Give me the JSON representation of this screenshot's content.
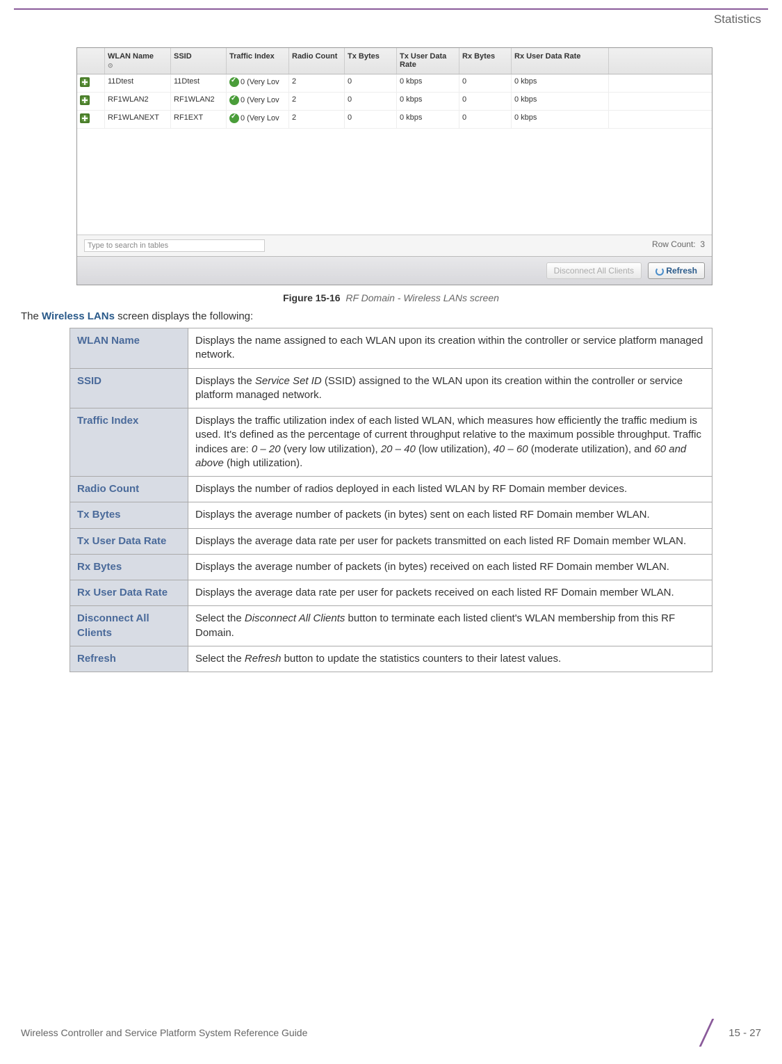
{
  "header": {
    "section": "Statistics"
  },
  "screenshot": {
    "columns": [
      "WLAN Name",
      "SSID",
      "Traffic Index",
      "Radio Count",
      "Tx Bytes",
      "Tx User Data Rate",
      "Rx Bytes",
      "Rx User Data Rate"
    ],
    "sort_indicator": "⊙",
    "rows": [
      {
        "wlan": "11Dtest",
        "ssid": "11Dtest",
        "traffic": "0 (Very Lov",
        "radio": "2",
        "txb": "0",
        "txr": "0 kbps",
        "rxb": "0",
        "rxr": "0 kbps"
      },
      {
        "wlan": "RF1WLAN2",
        "ssid": "RF1WLAN2",
        "traffic": "0 (Very Lov",
        "radio": "2",
        "txb": "0",
        "txr": "0 kbps",
        "rxb": "0",
        "rxr": "0 kbps"
      },
      {
        "wlan": "RF1WLANEXT",
        "ssid": "RF1EXT",
        "traffic": "0 (Very Lov",
        "radio": "2",
        "txb": "0",
        "txr": "0 kbps",
        "rxb": "0",
        "rxr": "0 kbps"
      }
    ],
    "search_placeholder": "Type to search in tables",
    "row_count_label": "Row Count:",
    "row_count": "3",
    "btn_disconnect": "Disconnect All Clients",
    "btn_refresh": "Refresh"
  },
  "figure": {
    "number": "Figure 15-16",
    "desc": "RF Domain - Wireless LANs screen"
  },
  "intro": {
    "pre": "The ",
    "bold": "Wireless LANs",
    "post": " screen displays the following:"
  },
  "defs": [
    {
      "term": "WLAN Name",
      "html": "Displays the name assigned to each WLAN upon its creation within the controller or service platform managed network."
    },
    {
      "term": "SSID",
      "html": "Displays the <i>Service Set ID</i> (SSID) assigned to the WLAN upon its creation within the controller or service platform managed network."
    },
    {
      "term": "Traffic Index",
      "html": "Displays the traffic utilization index of each listed WLAN, which measures how efficiently the traffic medium is used. It's defined as the percentage of current throughput relative to the maximum possible throughput. Traffic indices are: <i>0 – 20</i> (very low utilization), <i>20 – 40</i> (low utilization), <i>40 – 60</i> (moderate utilization), and <i>60 and above</i> (high utilization)."
    },
    {
      "term": "Radio Count",
      "html": "Displays the number of radios deployed in each listed WLAN by RF Domain member devices."
    },
    {
      "term": "Tx Bytes",
      "html": "Displays the average number of packets (in bytes) sent on each listed RF Domain member WLAN."
    },
    {
      "term": "Tx User Data Rate",
      "html": "Displays the average data rate per user for packets transmitted on each listed RF Domain member WLAN."
    },
    {
      "term": "Rx Bytes",
      "html": "Displays the average number of packets (in bytes) received on each listed RF Domain member WLAN."
    },
    {
      "term": "Rx User Data Rate",
      "html": "Displays the average data rate per user for packets received on each listed RF Domain member WLAN."
    },
    {
      "term": "Disconnect All Clients",
      "html": "Select the <i>Disconnect All Clients</i> button to terminate each listed client's WLAN membership from this RF Domain."
    },
    {
      "term": "Refresh",
      "html": "Select the <i>Refresh</i> button to update the statistics counters to their latest values."
    }
  ],
  "footer": {
    "text": "Wireless Controller and Service Platform System Reference Guide",
    "page": "15 - 27"
  }
}
